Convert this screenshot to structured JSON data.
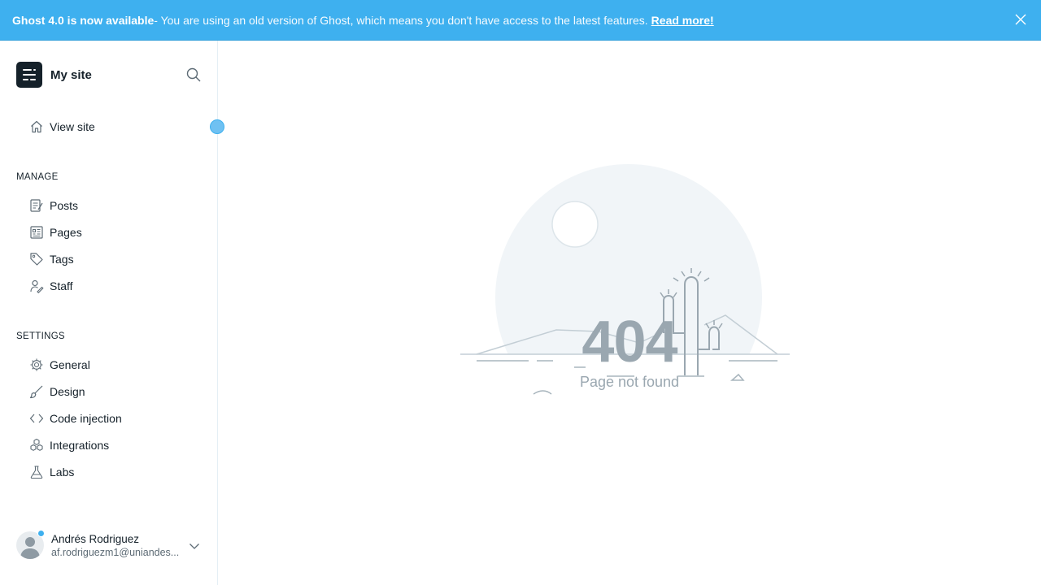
{
  "banner": {
    "title": "Ghost 4.0 is now available",
    "message": " - You are using an old version of Ghost, which means you don't have access to the latest features.",
    "link": "Read more!",
    "close_icon": "close-icon",
    "color": "#3eb0ef"
  },
  "sidebar": {
    "site_name": "My site",
    "view_site": "View site",
    "manage_title": "MANAGE",
    "manage_items": [
      "Posts",
      "Pages",
      "Tags",
      "Staff"
    ],
    "settings_title": "SETTINGS",
    "settings_items": [
      "General",
      "Design",
      "Code injection",
      "Integrations",
      "Labs"
    ]
  },
  "user": {
    "name": "Andrés Rodriguez",
    "email": "af.rodriguezm1@uniandes..."
  },
  "error": {
    "code": "404",
    "message": "Page not found"
  }
}
